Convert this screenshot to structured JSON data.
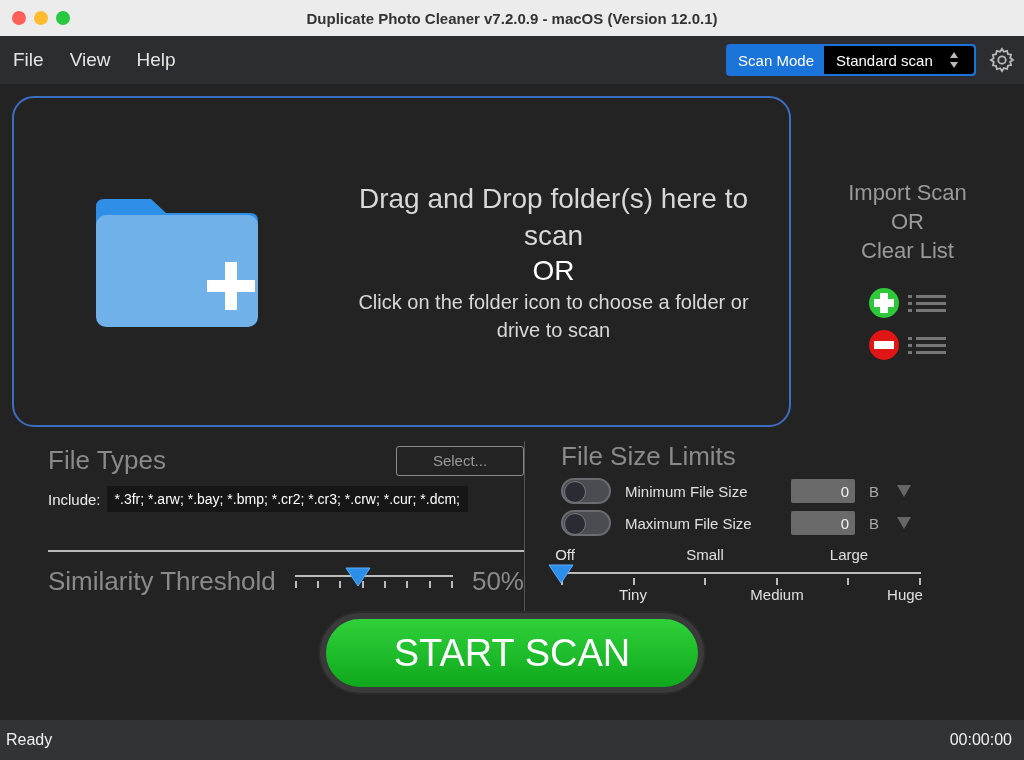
{
  "window": {
    "title": "Duplicate Photo Cleaner v7.2.0.9 - macOS (Version 12.0.1)"
  },
  "menu": [
    "File",
    "View",
    "Help"
  ],
  "scan_mode": {
    "label": "Scan Mode",
    "value": "Standard scan"
  },
  "drop_zone": {
    "headline": "Drag and Drop folder(s) here to scan",
    "or": "OR",
    "hint": "Click on the folder icon to choose a folder or drive to scan"
  },
  "import_panel": {
    "lines": [
      "Import Scan",
      "OR",
      "Clear List"
    ]
  },
  "file_types": {
    "title": "File Types",
    "select_button": "Select...",
    "include_label": "Include:",
    "include_value": "*.3fr; *.arw; *.bay; *.bmp; *.cr2; *.cr3; *.crw; *.cur; *.dcm;"
  },
  "similarity": {
    "label": "Similarity Threshold",
    "level": 0.4,
    "reading": "50%"
  },
  "file_size": {
    "title": "File Size Limits",
    "limits": [
      {
        "label": "Minimum File Size",
        "on": false,
        "value": "0",
        "unit": "B"
      },
      {
        "label": "Maximum File Size",
        "on": false,
        "value": "0",
        "unit": "B"
      }
    ],
    "level": 0,
    "stops": [
      "Off",
      "Tiny",
      "Small",
      "Medium",
      "Large",
      "Huge"
    ]
  },
  "start_button": "START SCAN",
  "status_bar": {
    "status": "Ready",
    "time": "00:00:00"
  }
}
